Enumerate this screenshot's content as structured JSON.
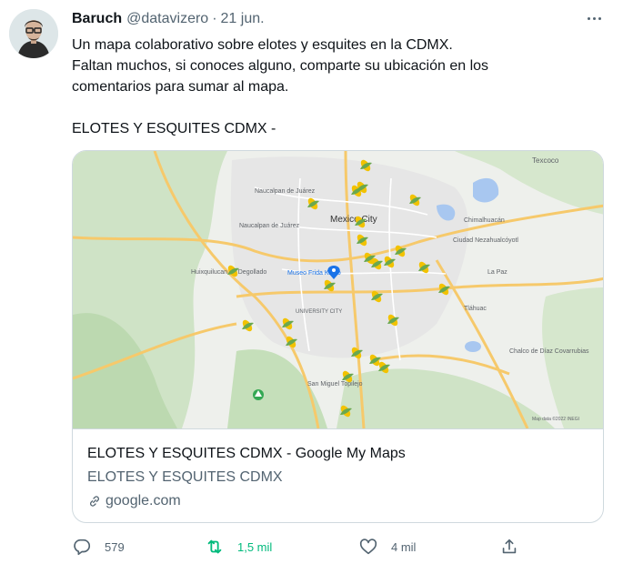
{
  "tweet": {
    "author_name": "Baruch",
    "handle": "@datavizero",
    "separator": "·",
    "date": "21 jun.",
    "lines": [
      "Un mapa colaborativo sobre elotes y esquites en la CDMX.",
      "Faltan muchos, si conoces alguno, comparte su ubicación en los",
      "comentarios para sumar al mapa."
    ],
    "headline": "ELOTES Y ESQUITES CDMX -"
  },
  "card": {
    "title": "ELOTES Y ESQUITES CDMX - Google My Maps",
    "description": "ELOTES Y ESQUITES CDMX",
    "domain": "google.com",
    "map_labels": {
      "texcoco": "Texcoco",
      "mexico_city": "Mexico City",
      "naucalpan": "Naucalpan de Juárez",
      "naucalpan2": "Naucalpan de Juárez",
      "huixquilucan": "Huixquilucan de Degollado",
      "museo": "Museo Frida Kahlo",
      "university": "UNIVERSITY CITY",
      "chimalhuacan": "Chimalhuacán",
      "netzahualcoyotl": "Ciudad Nezahualcóyotl",
      "la_paz": "La Paz",
      "san_miguel": "San Miguel Topilejo",
      "chalco": "Chalco de Díaz Covarrubias",
      "tlahuac": "Tláhuac",
      "credit": "Map data ©2022 INEGI"
    }
  },
  "actions": {
    "replies": "579",
    "retweets": "1,5 mil",
    "likes": "4 mil"
  },
  "colors": {
    "retweet_active": "#00ba7c",
    "secondary_text": "#536471",
    "border": "#cfd9de",
    "map_pin": "#f2c200"
  },
  "icons": [
    "more-icon",
    "reply-icon",
    "retweet-icon",
    "like-icon",
    "share-icon",
    "link-icon",
    "corn-pin-icon",
    "map-location-pin-icon",
    "park-marker-icon"
  ]
}
